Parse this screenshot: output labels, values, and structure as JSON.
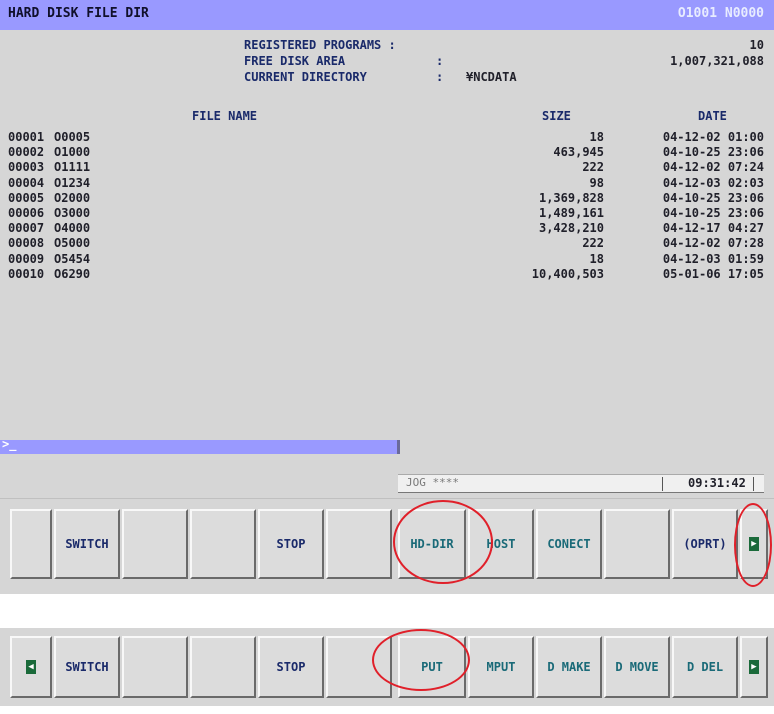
{
  "header": {
    "title": "HARD DISK FILE DIR",
    "program_number": "O1001 N0000"
  },
  "info": {
    "registered_programs_label": "REGISTERED PROGRAMS :",
    "registered_programs_value": "10",
    "free_disk_label": "FREE DISK AREA",
    "free_disk_colon": ":",
    "free_disk_value": "1,007,321,088",
    "current_dir_label": "CURRENT DIRECTORY",
    "current_dir_colon": ":",
    "current_dir_value": "¥NCDATA"
  },
  "table": {
    "headers": {
      "name": "FILE NAME",
      "size": "SIZE",
      "date": "DATE"
    },
    "rows": [
      {
        "no": "00001",
        "name": "O0005",
        "size": "18",
        "date": "04-12-02 01:00"
      },
      {
        "no": "00002",
        "name": "O1000",
        "size": "463,945",
        "date": "04-10-25 23:06"
      },
      {
        "no": "00003",
        "name": "O1111",
        "size": "222",
        "date": "04-12-02 07:24"
      },
      {
        "no": "00004",
        "name": "O1234",
        "size": "98",
        "date": "04-12-03 02:03"
      },
      {
        "no": "00005",
        "name": "O2000",
        "size": "1,369,828",
        "date": "04-10-25 23:06"
      },
      {
        "no": "00006",
        "name": "O3000",
        "size": "1,489,161",
        "date": "04-10-25 23:06"
      },
      {
        "no": "00007",
        "name": "O4000",
        "size": "3,428,210",
        "date": "04-12-17 04:27"
      },
      {
        "no": "00008",
        "name": "O5000",
        "size": "222",
        "date": "04-12-02 07:28"
      },
      {
        "no": "00009",
        "name": "O5454",
        "size": "18",
        "date": "04-12-03 01:59"
      },
      {
        "no": "00010",
        "name": "O6290",
        "size": "10,400,503",
        "date": "05-01-06 17:05"
      }
    ]
  },
  "command_line": {
    "prompt": ">_"
  },
  "status": {
    "mode": "JOG ****",
    "time": "09:31:42"
  },
  "softkeys_row1": {
    "k2": "SWITCH",
    "k5": "STOP",
    "k7": "HD-DIR",
    "k8": "HOST",
    "k9": "CONECT",
    "k11": "(OPRT)",
    "next_glyph": "▶"
  },
  "softkeys_row2": {
    "prev_glyph": "◀",
    "k2": "SWITCH",
    "k5": "STOP",
    "k7": "PUT",
    "k8": "MPUT",
    "k9": "D MAKE",
    "k10": "D MOVE",
    "k11": "D DEL",
    "next_glyph": "▶"
  },
  "colors": {
    "title_bar": "#9999ff",
    "screen_bg": "#d6d6d6",
    "text": "#1a2a6a",
    "highlight_circle": "#e0202a"
  }
}
